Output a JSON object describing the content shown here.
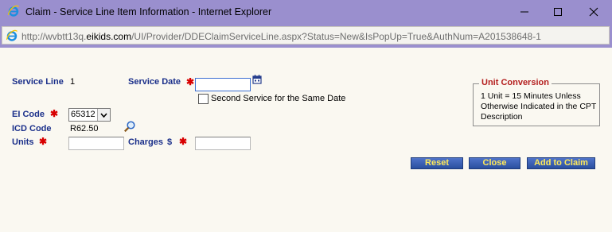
{
  "window": {
    "title": "Claim - Service Line Item Information - Internet Explorer",
    "address_prefix": "http://wvbtt13q.",
    "address_domain": "eikids.com",
    "address_suffix": "/UI/Provider/DDEClaimServiceLine.aspx?Status=New&IsPopUp=True&AuthNum=A201538648-1"
  },
  "form": {
    "service_line_label": "Service Line",
    "service_line_value": "1",
    "service_date_label": "Service Date",
    "service_date_value": "",
    "second_service_label": "Second Service for the Same Date",
    "ei_code_label": "EI Code",
    "ei_code_value": "65312",
    "icd_code_label": "ICD Code",
    "icd_code_value": "R62.50",
    "units_label": "Units",
    "units_value": "",
    "charges_label": "Charges",
    "charges_currency": "$",
    "charges_value": "",
    "required_mark": "✱"
  },
  "unit_conversion": {
    "title": "Unit Conversion",
    "text": "1 Unit = 15 Minutes Unless Otherwise Indicated in the CPT Description"
  },
  "buttons": {
    "reset": "Reset",
    "close": "Close",
    "add": "Add to Claim"
  },
  "icons": {
    "browser": "internet-explorer-icon",
    "calendar": "calendar-icon",
    "search": "magnifier-icon",
    "dropdown": "chevron-down-icon"
  }
}
